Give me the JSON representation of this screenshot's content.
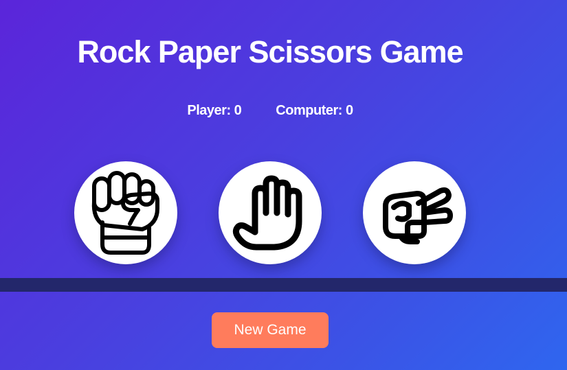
{
  "game": {
    "title": "Rock Paper Scissors Game"
  },
  "score": {
    "player_label": "Player: 0",
    "computer_label": "Computer: 0",
    "player": 0,
    "computer": 0
  },
  "choices": [
    {
      "id": "rock",
      "icon": "fist-icon"
    },
    {
      "id": "paper",
      "icon": "open-hand-icon"
    },
    {
      "id": "scissors",
      "icon": "scissors-hand-icon"
    }
  ],
  "result": {
    "text": ""
  },
  "controls": {
    "new_game_label": "New Game"
  },
  "colors": {
    "background_start": "#5b25da",
    "background_end": "#2f66ef",
    "result_bar": "#23276b",
    "button": "#ff7c5c",
    "text": "#ffffff"
  }
}
